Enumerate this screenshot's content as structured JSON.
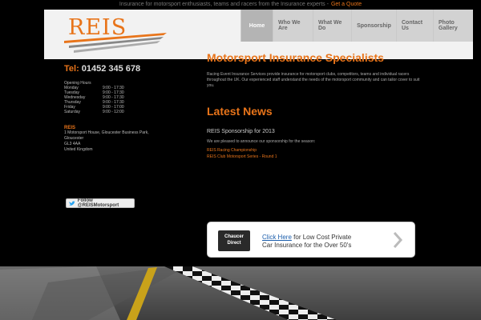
{
  "topbar": {
    "text": "Insurance for motorsport enthusiasts, teams and racers from the Insurance experts -",
    "link": "Get a Quote"
  },
  "logo": {
    "text": "REIS"
  },
  "nav": [
    {
      "label": "Home",
      "active": true
    },
    {
      "label": "Who We Are",
      "active": false
    },
    {
      "label": "What We Do",
      "active": false
    },
    {
      "label": "Sponsorship",
      "active": false
    },
    {
      "label": "Contact Us",
      "active": false
    },
    {
      "label": "Photo Gallery",
      "active": false
    }
  ],
  "sidebar": {
    "tel_label": "Tel:",
    "tel_number": "01452 345 678",
    "hours_title": "Opening Hours",
    "hours": [
      {
        "day": "Monday",
        "time": "9:00 - 17:30"
      },
      {
        "day": "Tuesday",
        "time": "9:00 - 17:30"
      },
      {
        "day": "Wednesday",
        "time": "9:00 - 17:30"
      },
      {
        "day": "Thursday",
        "time": "9:00 - 17:30"
      },
      {
        "day": "Friday",
        "time": "9:00 - 17:00"
      },
      {
        "day": "Saturday",
        "time": "9:00 - 12:00"
      }
    ],
    "address_title": "REIS",
    "address": [
      "1 Motorsport House, Gloucester Business Park,",
      "Gloucester",
      "GL3 4AA",
      "United Kingdom"
    ],
    "twitter_label": "Follow @REISMotorsport"
  },
  "main": {
    "title": "Motorsport Insurance Specialists",
    "intro": "Racing Event Insurance Services provide insurance for motorsport clubs, competitors, teams and individual racers throughout the UK. Our experienced staff understand the needs of the motorsport community and can tailor cover to suit you.",
    "news_title": "Latest News",
    "news_sub": "REIS Sponsorship for 2013",
    "news_body": "We are pleased to announce our sponsorship for the season:",
    "news_links": [
      "REIS Racing Championship",
      "REIS Club Motorsport Series - Round 1"
    ]
  },
  "promo": {
    "logo_line1": "Chaucer",
    "logo_line2": "Direct",
    "link": "Click Here",
    "text1": "for Low Cost Private",
    "text2": "Car Insurance for the Over 50's"
  },
  "colors": {
    "accent": "#e8741a",
    "background": "#000000",
    "nav": "#d2d2d2"
  }
}
